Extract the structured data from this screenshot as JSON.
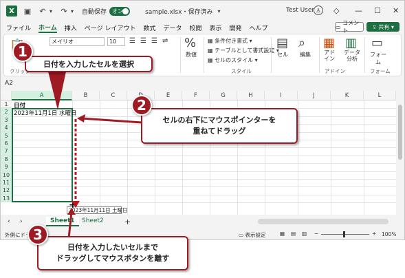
{
  "titlebar": {
    "autosave_label": "自動保存",
    "autosave_state": "オン",
    "filename": "sample.xlsx・保存済み",
    "search_label": "検索",
    "user": "Test User"
  },
  "menu": {
    "tabs": [
      "ファイル",
      "ホーム",
      "挿入",
      "ページ レイアウト",
      "数式",
      "データ",
      "校閲",
      "表示",
      "開発",
      "ヘルプ"
    ],
    "active_tab": "ホーム",
    "comment_label": "コメント",
    "share_label": "共有"
  },
  "ribbon": {
    "font_name": "メイリオ",
    "font_size": "10",
    "clipboard_label": "クリップ",
    "number_format_label": "数値",
    "percent_icon": "%",
    "conditional_format": "条件付き書式",
    "table_format": "テーブルとして書式設定",
    "cell_style": "セルのスタイル",
    "style_group": "スタイル",
    "cells_label": "セル",
    "edit_label": "編集",
    "addin_label": "アド\nイン",
    "data_analysis_label": "データ\n分析",
    "addin_group": "アドイン",
    "form_label": "フォーム",
    "form_group": "フォーム"
  },
  "formula": {
    "namebox": "A2"
  },
  "grid": {
    "columns": [
      "A",
      "B",
      "C",
      "D",
      "E",
      "F",
      "G",
      "H",
      "I",
      "J",
      "K",
      "L"
    ],
    "rows": [
      "1",
      "2",
      "3",
      "4",
      "5",
      "6",
      "7",
      "8",
      "9",
      "10",
      "11",
      "12",
      "13"
    ],
    "a1": "日付",
    "a2": "2023年11月1日 水曜日",
    "drag_tooltip": "2023年11月11日 土曜日"
  },
  "sheets": {
    "tabs": [
      "Sheet1",
      "Sheet2"
    ],
    "active": "Sheet1",
    "add_icon": "+"
  },
  "status": {
    "left": "外側にドラッグ…",
    "display_settings": "表示設定",
    "zoom": "100%"
  },
  "callouts": {
    "c1_num": "1",
    "c1_text": "日付を入力したセルを選択",
    "c2_num": "2",
    "c2_text_1": "セルの右下にマウスポインターを",
    "c2_text_2": "重ねてドラッグ",
    "c3_num": "3",
    "c3_text_1": "日付を入力したいセルまで",
    "c3_text_2": "ドラッグしてマウスボタンを離す"
  },
  "colors": {
    "excel_green": "#1d6f42",
    "callout_red": "#9e1b24"
  }
}
